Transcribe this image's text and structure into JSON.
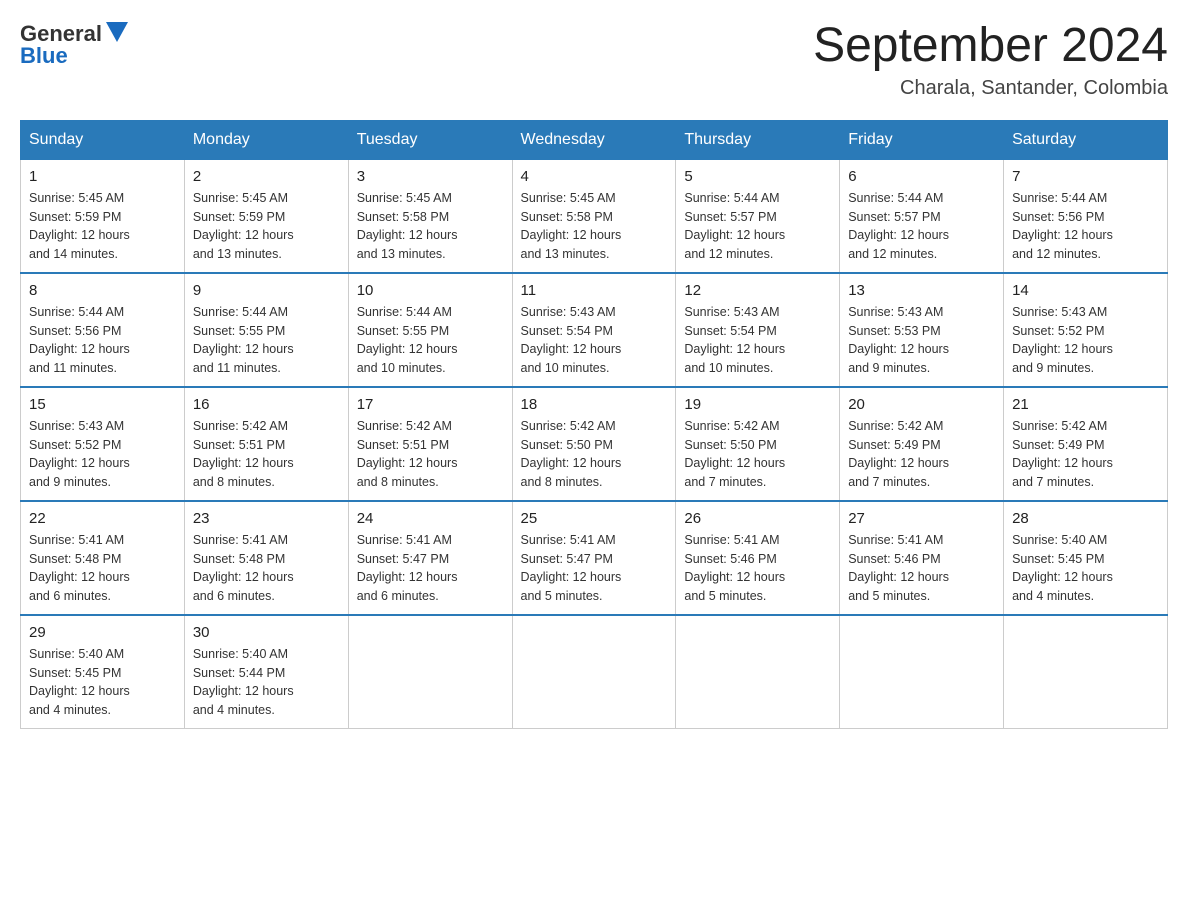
{
  "header": {
    "logo_general": "General",
    "logo_blue": "Blue",
    "title": "September 2024",
    "subtitle": "Charala, Santander, Colombia"
  },
  "weekdays": [
    "Sunday",
    "Monday",
    "Tuesday",
    "Wednesday",
    "Thursday",
    "Friday",
    "Saturday"
  ],
  "weeks": [
    [
      {
        "day": "1",
        "sunrise": "5:45 AM",
        "sunset": "5:59 PM",
        "daylight": "12 hours and 14 minutes."
      },
      {
        "day": "2",
        "sunrise": "5:45 AM",
        "sunset": "5:59 PM",
        "daylight": "12 hours and 13 minutes."
      },
      {
        "day": "3",
        "sunrise": "5:45 AM",
        "sunset": "5:58 PM",
        "daylight": "12 hours and 13 minutes."
      },
      {
        "day": "4",
        "sunrise": "5:45 AM",
        "sunset": "5:58 PM",
        "daylight": "12 hours and 13 minutes."
      },
      {
        "day": "5",
        "sunrise": "5:44 AM",
        "sunset": "5:57 PM",
        "daylight": "12 hours and 12 minutes."
      },
      {
        "day": "6",
        "sunrise": "5:44 AM",
        "sunset": "5:57 PM",
        "daylight": "12 hours and 12 minutes."
      },
      {
        "day": "7",
        "sunrise": "5:44 AM",
        "sunset": "5:56 PM",
        "daylight": "12 hours and 12 minutes."
      }
    ],
    [
      {
        "day": "8",
        "sunrise": "5:44 AM",
        "sunset": "5:56 PM",
        "daylight": "12 hours and 11 minutes."
      },
      {
        "day": "9",
        "sunrise": "5:44 AM",
        "sunset": "5:55 PM",
        "daylight": "12 hours and 11 minutes."
      },
      {
        "day": "10",
        "sunrise": "5:44 AM",
        "sunset": "5:55 PM",
        "daylight": "12 hours and 10 minutes."
      },
      {
        "day": "11",
        "sunrise": "5:43 AM",
        "sunset": "5:54 PM",
        "daylight": "12 hours and 10 minutes."
      },
      {
        "day": "12",
        "sunrise": "5:43 AM",
        "sunset": "5:54 PM",
        "daylight": "12 hours and 10 minutes."
      },
      {
        "day": "13",
        "sunrise": "5:43 AM",
        "sunset": "5:53 PM",
        "daylight": "12 hours and 9 minutes."
      },
      {
        "day": "14",
        "sunrise": "5:43 AM",
        "sunset": "5:52 PM",
        "daylight": "12 hours and 9 minutes."
      }
    ],
    [
      {
        "day": "15",
        "sunrise": "5:43 AM",
        "sunset": "5:52 PM",
        "daylight": "12 hours and 9 minutes."
      },
      {
        "day": "16",
        "sunrise": "5:42 AM",
        "sunset": "5:51 PM",
        "daylight": "12 hours and 8 minutes."
      },
      {
        "day": "17",
        "sunrise": "5:42 AM",
        "sunset": "5:51 PM",
        "daylight": "12 hours and 8 minutes."
      },
      {
        "day": "18",
        "sunrise": "5:42 AM",
        "sunset": "5:50 PM",
        "daylight": "12 hours and 8 minutes."
      },
      {
        "day": "19",
        "sunrise": "5:42 AM",
        "sunset": "5:50 PM",
        "daylight": "12 hours and 7 minutes."
      },
      {
        "day": "20",
        "sunrise": "5:42 AM",
        "sunset": "5:49 PM",
        "daylight": "12 hours and 7 minutes."
      },
      {
        "day": "21",
        "sunrise": "5:42 AM",
        "sunset": "5:49 PM",
        "daylight": "12 hours and 7 minutes."
      }
    ],
    [
      {
        "day": "22",
        "sunrise": "5:41 AM",
        "sunset": "5:48 PM",
        "daylight": "12 hours and 6 minutes."
      },
      {
        "day": "23",
        "sunrise": "5:41 AM",
        "sunset": "5:48 PM",
        "daylight": "12 hours and 6 minutes."
      },
      {
        "day": "24",
        "sunrise": "5:41 AM",
        "sunset": "5:47 PM",
        "daylight": "12 hours and 6 minutes."
      },
      {
        "day": "25",
        "sunrise": "5:41 AM",
        "sunset": "5:47 PM",
        "daylight": "12 hours and 5 minutes."
      },
      {
        "day": "26",
        "sunrise": "5:41 AM",
        "sunset": "5:46 PM",
        "daylight": "12 hours and 5 minutes."
      },
      {
        "day": "27",
        "sunrise": "5:41 AM",
        "sunset": "5:46 PM",
        "daylight": "12 hours and 5 minutes."
      },
      {
        "day": "28",
        "sunrise": "5:40 AM",
        "sunset": "5:45 PM",
        "daylight": "12 hours and 4 minutes."
      }
    ],
    [
      {
        "day": "29",
        "sunrise": "5:40 AM",
        "sunset": "5:45 PM",
        "daylight": "12 hours and 4 minutes."
      },
      {
        "day": "30",
        "sunrise": "5:40 AM",
        "sunset": "5:44 PM",
        "daylight": "12 hours and 4 minutes."
      },
      null,
      null,
      null,
      null,
      null
    ]
  ],
  "labels": {
    "sunrise": "Sunrise:",
    "sunset": "Sunset:",
    "daylight": "Daylight:"
  }
}
